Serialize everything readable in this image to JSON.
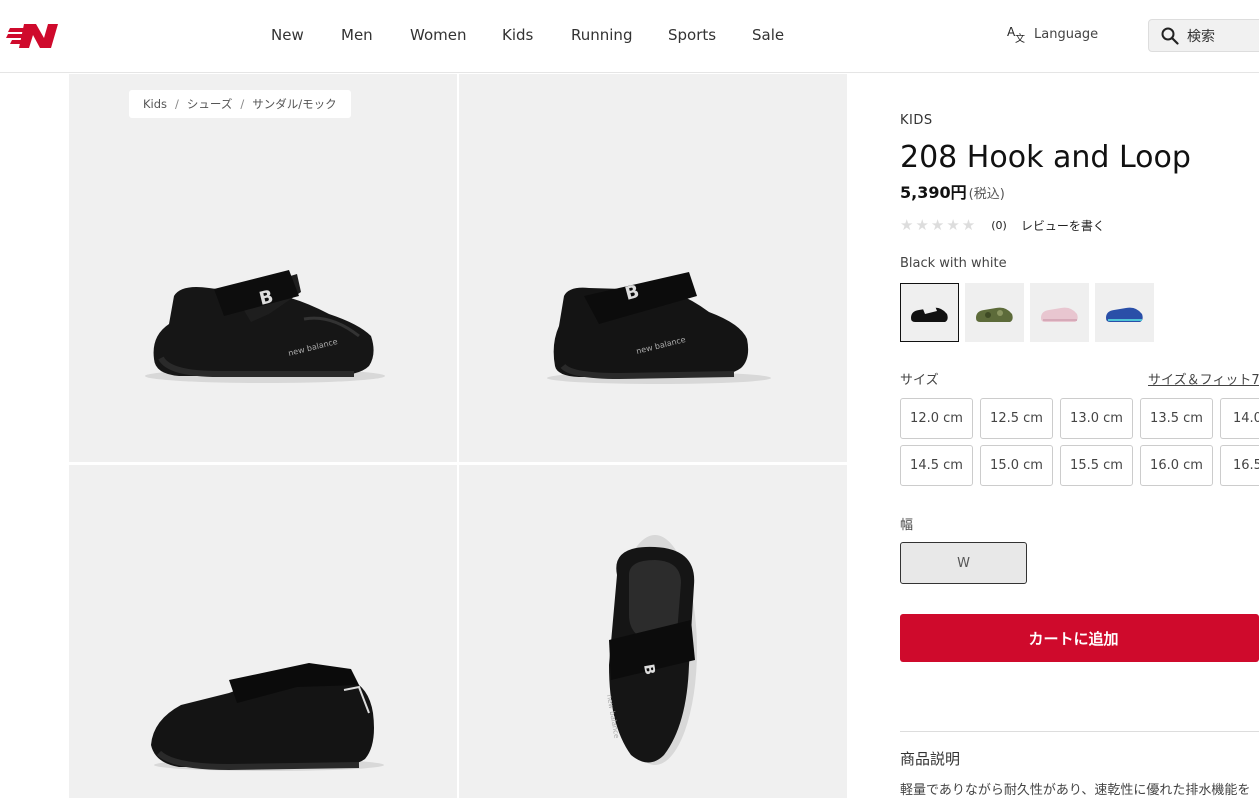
{
  "header": {
    "logo_alt": "NB",
    "nav": [
      "New",
      "Men",
      "Women",
      "Kids",
      "Running",
      "Sports",
      "Sale"
    ],
    "language_label": "Language",
    "search_placeholder": "検索"
  },
  "breadcrumb": [
    "Kids",
    "シューズ",
    "サンダル/モック"
  ],
  "product": {
    "kicker": "KIDS",
    "title": "208 Hook and Loop",
    "price": "5,390円",
    "tax_note": "(税込)",
    "rating_count": "(0)",
    "write_review": "レビューを書く",
    "color_name": "Black with white",
    "swatches": [
      {
        "name": "black",
        "color": "#111111"
      },
      {
        "name": "olive-camo",
        "color": "#5d6b3a"
      },
      {
        "name": "pink",
        "color": "#e8c6d0"
      },
      {
        "name": "blue",
        "color": "#2a4fa8"
      }
    ],
    "size_label": "サイズ",
    "size_guide": "サイズ＆フィット7",
    "sizes_row1": [
      "12.0 cm",
      "12.5 cm",
      "13.0 cm",
      "13.5 cm",
      "14.0"
    ],
    "sizes_row2": [
      "14.5 cm",
      "15.0 cm",
      "15.5 cm",
      "16.0 cm",
      "16.5"
    ],
    "width_label": "幅",
    "width_value": "W",
    "add_to_cart": "カートに追加",
    "description_title": "商品説明",
    "description_text": "軽量でありながら耐久性があり、速乾性に優れた排水機能を"
  },
  "colors": {
    "brand_red": "#cf0a2c"
  }
}
